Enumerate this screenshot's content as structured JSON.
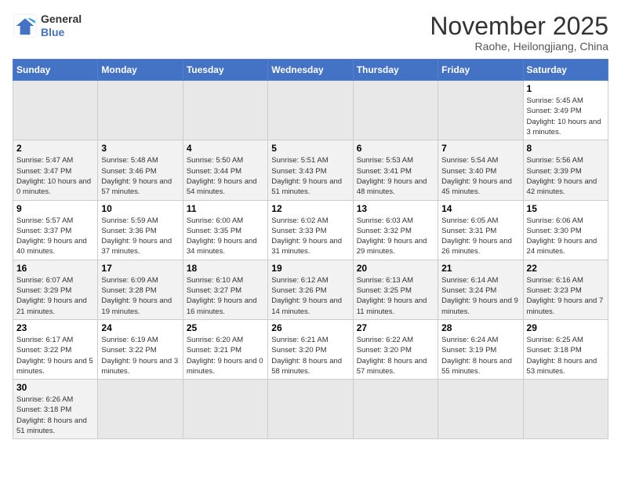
{
  "header": {
    "logo_general": "General",
    "logo_blue": "Blue",
    "month_title": "November 2025",
    "subtitle": "Raohe, Heilongjiang, China"
  },
  "weekdays": [
    "Sunday",
    "Monday",
    "Tuesday",
    "Wednesday",
    "Thursday",
    "Friday",
    "Saturday"
  ],
  "weeks": [
    [
      {
        "day": "",
        "info": ""
      },
      {
        "day": "",
        "info": ""
      },
      {
        "day": "",
        "info": ""
      },
      {
        "day": "",
        "info": ""
      },
      {
        "day": "",
        "info": ""
      },
      {
        "day": "",
        "info": ""
      },
      {
        "day": "1",
        "info": "Sunrise: 5:45 AM\nSunset: 3:49 PM\nDaylight: 10 hours and 3 minutes."
      }
    ],
    [
      {
        "day": "2",
        "info": "Sunrise: 5:47 AM\nSunset: 3:47 PM\nDaylight: 10 hours and 0 minutes."
      },
      {
        "day": "3",
        "info": "Sunrise: 5:48 AM\nSunset: 3:46 PM\nDaylight: 9 hours and 57 minutes."
      },
      {
        "day": "4",
        "info": "Sunrise: 5:50 AM\nSunset: 3:44 PM\nDaylight: 9 hours and 54 minutes."
      },
      {
        "day": "5",
        "info": "Sunrise: 5:51 AM\nSunset: 3:43 PM\nDaylight: 9 hours and 51 minutes."
      },
      {
        "day": "6",
        "info": "Sunrise: 5:53 AM\nSunset: 3:41 PM\nDaylight: 9 hours and 48 minutes."
      },
      {
        "day": "7",
        "info": "Sunrise: 5:54 AM\nSunset: 3:40 PM\nDaylight: 9 hours and 45 minutes."
      },
      {
        "day": "8",
        "info": "Sunrise: 5:56 AM\nSunset: 3:39 PM\nDaylight: 9 hours and 42 minutes."
      }
    ],
    [
      {
        "day": "9",
        "info": "Sunrise: 5:57 AM\nSunset: 3:37 PM\nDaylight: 9 hours and 40 minutes."
      },
      {
        "day": "10",
        "info": "Sunrise: 5:59 AM\nSunset: 3:36 PM\nDaylight: 9 hours and 37 minutes."
      },
      {
        "day": "11",
        "info": "Sunrise: 6:00 AM\nSunset: 3:35 PM\nDaylight: 9 hours and 34 minutes."
      },
      {
        "day": "12",
        "info": "Sunrise: 6:02 AM\nSunset: 3:33 PM\nDaylight: 9 hours and 31 minutes."
      },
      {
        "day": "13",
        "info": "Sunrise: 6:03 AM\nSunset: 3:32 PM\nDaylight: 9 hours and 29 minutes."
      },
      {
        "day": "14",
        "info": "Sunrise: 6:05 AM\nSunset: 3:31 PM\nDaylight: 9 hours and 26 minutes."
      },
      {
        "day": "15",
        "info": "Sunrise: 6:06 AM\nSunset: 3:30 PM\nDaylight: 9 hours and 24 minutes."
      }
    ],
    [
      {
        "day": "16",
        "info": "Sunrise: 6:07 AM\nSunset: 3:29 PM\nDaylight: 9 hours and 21 minutes."
      },
      {
        "day": "17",
        "info": "Sunrise: 6:09 AM\nSunset: 3:28 PM\nDaylight: 9 hours and 19 minutes."
      },
      {
        "day": "18",
        "info": "Sunrise: 6:10 AM\nSunset: 3:27 PM\nDaylight: 9 hours and 16 minutes."
      },
      {
        "day": "19",
        "info": "Sunrise: 6:12 AM\nSunset: 3:26 PM\nDaylight: 9 hours and 14 minutes."
      },
      {
        "day": "20",
        "info": "Sunrise: 6:13 AM\nSunset: 3:25 PM\nDaylight: 9 hours and 11 minutes."
      },
      {
        "day": "21",
        "info": "Sunrise: 6:14 AM\nSunset: 3:24 PM\nDaylight: 9 hours and 9 minutes."
      },
      {
        "day": "22",
        "info": "Sunrise: 6:16 AM\nSunset: 3:23 PM\nDaylight: 9 hours and 7 minutes."
      }
    ],
    [
      {
        "day": "23",
        "info": "Sunrise: 6:17 AM\nSunset: 3:22 PM\nDaylight: 9 hours and 5 minutes."
      },
      {
        "day": "24",
        "info": "Sunrise: 6:19 AM\nSunset: 3:22 PM\nDaylight: 9 hours and 3 minutes."
      },
      {
        "day": "25",
        "info": "Sunrise: 6:20 AM\nSunset: 3:21 PM\nDaylight: 9 hours and 0 minutes."
      },
      {
        "day": "26",
        "info": "Sunrise: 6:21 AM\nSunset: 3:20 PM\nDaylight: 8 hours and 58 minutes."
      },
      {
        "day": "27",
        "info": "Sunrise: 6:22 AM\nSunset: 3:20 PM\nDaylight: 8 hours and 57 minutes."
      },
      {
        "day": "28",
        "info": "Sunrise: 6:24 AM\nSunset: 3:19 PM\nDaylight: 8 hours and 55 minutes."
      },
      {
        "day": "29",
        "info": "Sunrise: 6:25 AM\nSunset: 3:18 PM\nDaylight: 8 hours and 53 minutes."
      }
    ],
    [
      {
        "day": "30",
        "info": "Sunrise: 6:26 AM\nSunset: 3:18 PM\nDaylight: 8 hours and 51 minutes."
      },
      {
        "day": "",
        "info": ""
      },
      {
        "day": "",
        "info": ""
      },
      {
        "day": "",
        "info": ""
      },
      {
        "day": "",
        "info": ""
      },
      {
        "day": "",
        "info": ""
      },
      {
        "day": "",
        "info": ""
      }
    ]
  ]
}
